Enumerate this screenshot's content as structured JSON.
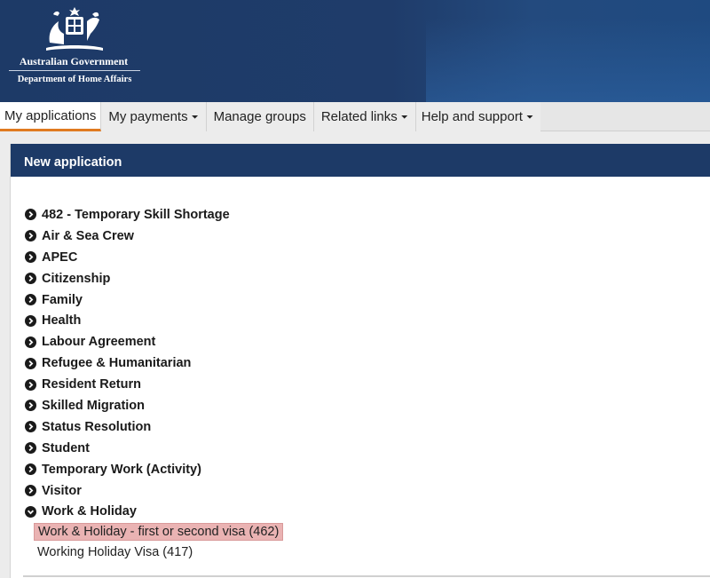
{
  "header": {
    "gov_name": "Australian Government",
    "dept_name": "Department of Home Affairs",
    "crest_icon": "coat-of-arms-icon"
  },
  "nav": {
    "items": [
      {
        "label": "My applications",
        "active": true,
        "dropdown": false
      },
      {
        "label": "My payments",
        "active": false,
        "dropdown": true
      },
      {
        "label": "Manage groups",
        "active": false,
        "dropdown": false
      },
      {
        "label": "Related links",
        "active": false,
        "dropdown": true
      },
      {
        "label": "Help and support",
        "active": false,
        "dropdown": true
      }
    ],
    "caret": "⏷"
  },
  "panel": {
    "title": "New application",
    "categories": [
      {
        "label": "482 - Temporary Skill Shortage",
        "expanded": false
      },
      {
        "label": "Air & Sea Crew",
        "expanded": false
      },
      {
        "label": "APEC",
        "expanded": false
      },
      {
        "label": "Citizenship",
        "expanded": false
      },
      {
        "label": "Family",
        "expanded": false
      },
      {
        "label": "Health",
        "expanded": false
      },
      {
        "label": "Labour Agreement",
        "expanded": false
      },
      {
        "label": "Refugee & Humanitarian",
        "expanded": false
      },
      {
        "label": "Resident Return",
        "expanded": false
      },
      {
        "label": "Skilled Migration",
        "expanded": false
      },
      {
        "label": "Status Resolution",
        "expanded": false
      },
      {
        "label": "Student",
        "expanded": false
      },
      {
        "label": "Temporary Work (Activity)",
        "expanded": false
      },
      {
        "label": "Visitor",
        "expanded": false
      },
      {
        "label": "Work & Holiday",
        "expanded": true
      }
    ],
    "subitems": [
      {
        "label": "Work & Holiday - first or second visa (462)",
        "highlighted": true
      },
      {
        "label": "Working Holiday Visa (417)",
        "highlighted": false
      }
    ]
  },
  "colors": {
    "brand_navy": "#1d3a67",
    "active_tab_accent": "#e07a20",
    "highlight": "#eab3b3"
  }
}
